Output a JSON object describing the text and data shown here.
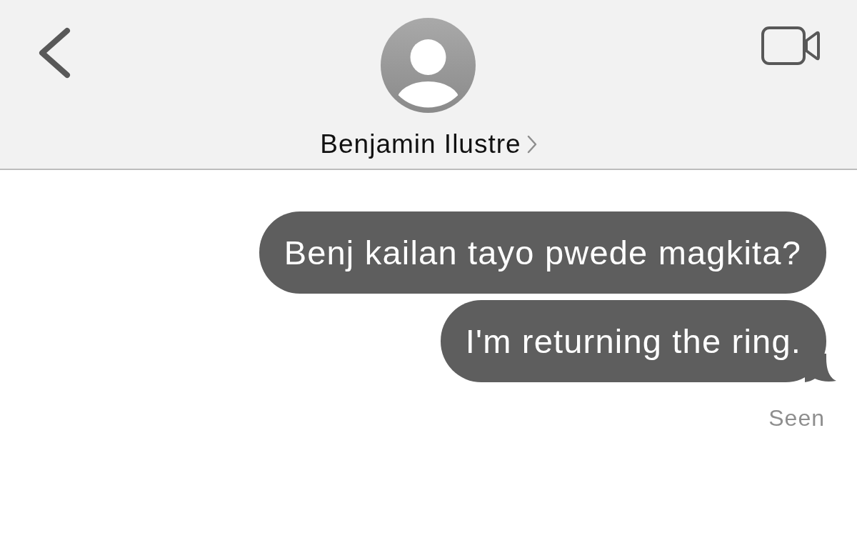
{
  "header": {
    "contact_name": "Benjamin Ilustre"
  },
  "messages": [
    {
      "text": "Benj kailan tayo pwede magkita?",
      "tail": false
    },
    {
      "text": "I'm returning the ring.",
      "tail": true
    }
  ],
  "delivery_status": "Seen"
}
